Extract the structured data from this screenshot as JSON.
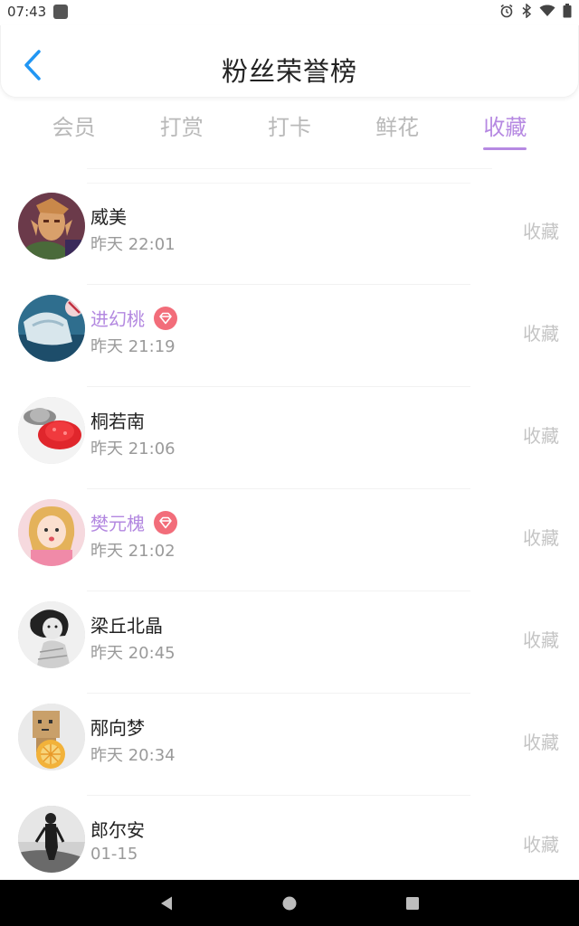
{
  "status_bar": {
    "time": "07:43",
    "icons": [
      "app-icon",
      "alarm-icon",
      "bluetooth-icon",
      "wifi-icon",
      "battery-icon"
    ]
  },
  "header": {
    "title": "粉丝荣誉榜",
    "back_icon": "chevron-left-icon",
    "accent_color": "#2196F3"
  },
  "tabs": [
    {
      "label": "会员",
      "active": false
    },
    {
      "label": "打赏",
      "active": false
    },
    {
      "label": "打卡",
      "active": false
    },
    {
      "label": "鲜花",
      "active": false
    },
    {
      "label": "收藏",
      "active": true
    }
  ],
  "colors": {
    "active_tab": "#b689e2",
    "vip_name": "#b388e0",
    "vip_badge": "#f26d7a",
    "muted_text": "#9a9a9a",
    "action_text": "#c4c4c4"
  },
  "fans": [
    {
      "name": "威美",
      "time": "昨天 22:01",
      "vip": false,
      "action": "收藏"
    },
    {
      "name": "进幻桃",
      "time": "昨天 21:19",
      "vip": true,
      "action": "收藏"
    },
    {
      "name": "桐若南",
      "time": "昨天 21:06",
      "vip": false,
      "action": "收藏"
    },
    {
      "name": "樊元槐",
      "time": "昨天 21:02",
      "vip": true,
      "action": "收藏"
    },
    {
      "name": "梁丘北晶",
      "time": "昨天 20:45",
      "vip": false,
      "action": "收藏"
    },
    {
      "name": "邴向梦",
      "time": "昨天 20:34",
      "vip": false,
      "action": "收藏"
    },
    {
      "name": "郎尔安",
      "time": "01-15",
      "vip": false,
      "action": "收藏"
    }
  ],
  "nav_bar": {
    "icons": [
      "back-triangle-icon",
      "home-circle-icon",
      "recents-square-icon"
    ]
  }
}
